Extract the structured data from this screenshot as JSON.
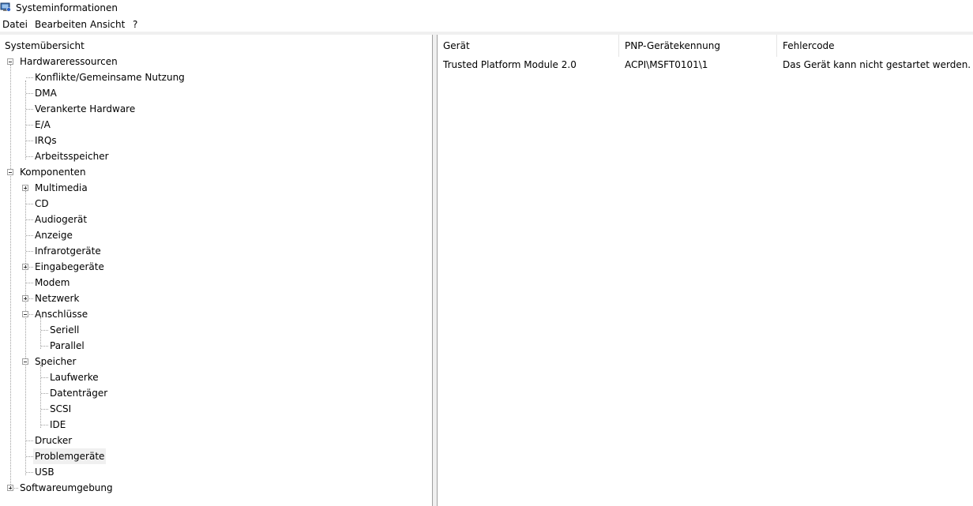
{
  "window": {
    "title": "Systeminformationen"
  },
  "menu": [
    "Datei",
    "Bearbeiten",
    "Ansicht",
    "?"
  ],
  "tree": {
    "root": "Systemübersicht",
    "hardware": {
      "label": "Hardwareressourcen",
      "children": [
        "Konflikte/Gemeinsame Nutzung",
        "DMA",
        "Verankerte Hardware",
        "E/A",
        "IRQs",
        "Arbeitsspeicher"
      ]
    },
    "komponenten": {
      "label": "Komponenten",
      "multimedia": "Multimedia",
      "cd": "CD",
      "audio": "Audiogerät",
      "anzeige": "Anzeige",
      "infrarot": "Infrarotgeräte",
      "eingabe": "Eingabegeräte",
      "modem": "Modem",
      "netzwerk": "Netzwerk",
      "anschluesse": {
        "label": "Anschlüsse",
        "children": [
          "Seriell",
          "Parallel"
        ]
      },
      "speicher": {
        "label": "Speicher",
        "children": [
          "Laufwerke",
          "Datenträger",
          "SCSI",
          "IDE"
        ]
      },
      "drucker": "Drucker",
      "problem": "Problemgeräte",
      "usb": "USB"
    },
    "software": "Softwareumgebung"
  },
  "list": {
    "columns": [
      "Gerät",
      "PNP-Gerätekennung",
      "Fehlercode"
    ],
    "rows": [
      [
        "Trusted Platform Module 2.0",
        "ACPI\\MSFT0101\\1",
        "Das Gerät kann nicht gestartet werden."
      ]
    ]
  },
  "colors": {
    "selection": "#f0f0f0",
    "treeLine": "#a0a0a0"
  }
}
